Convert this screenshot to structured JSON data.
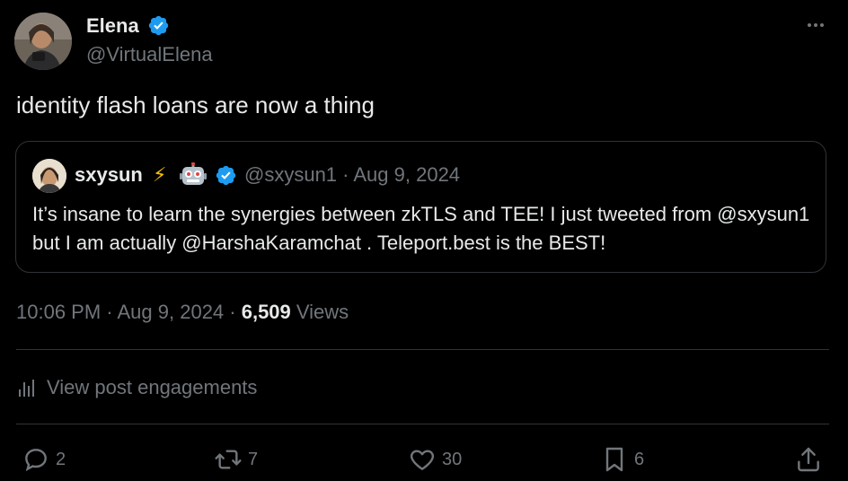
{
  "post": {
    "author_name": "Elena",
    "author_handle": "@VirtualElena",
    "text": "identity flash loans are now a thing",
    "timestamp": "10:06 PM · Aug 9, 2024 · ",
    "views_count": "6,509",
    "views_label": " Views",
    "engagements_label": "View post engagements"
  },
  "quote": {
    "author_name": "sxysun",
    "emoji_bolt": "⚡",
    "meta": "@sxysun1 · Aug 9, 2024",
    "text": "It’s insane to learn the synergies between zkTLS and TEE! I just tweeted from @sxysun1 but I am actually @HarshaKaramchat . Teleport.best is the BEST!"
  },
  "actions": {
    "replies": "2",
    "reposts": "7",
    "likes": "30",
    "bookmarks": "6"
  },
  "colors": {
    "background": "#000000",
    "text_primary": "#e7e9ea",
    "text_secondary": "#71767b",
    "verified_blue": "#1d9bf0",
    "border": "#2f3336"
  }
}
